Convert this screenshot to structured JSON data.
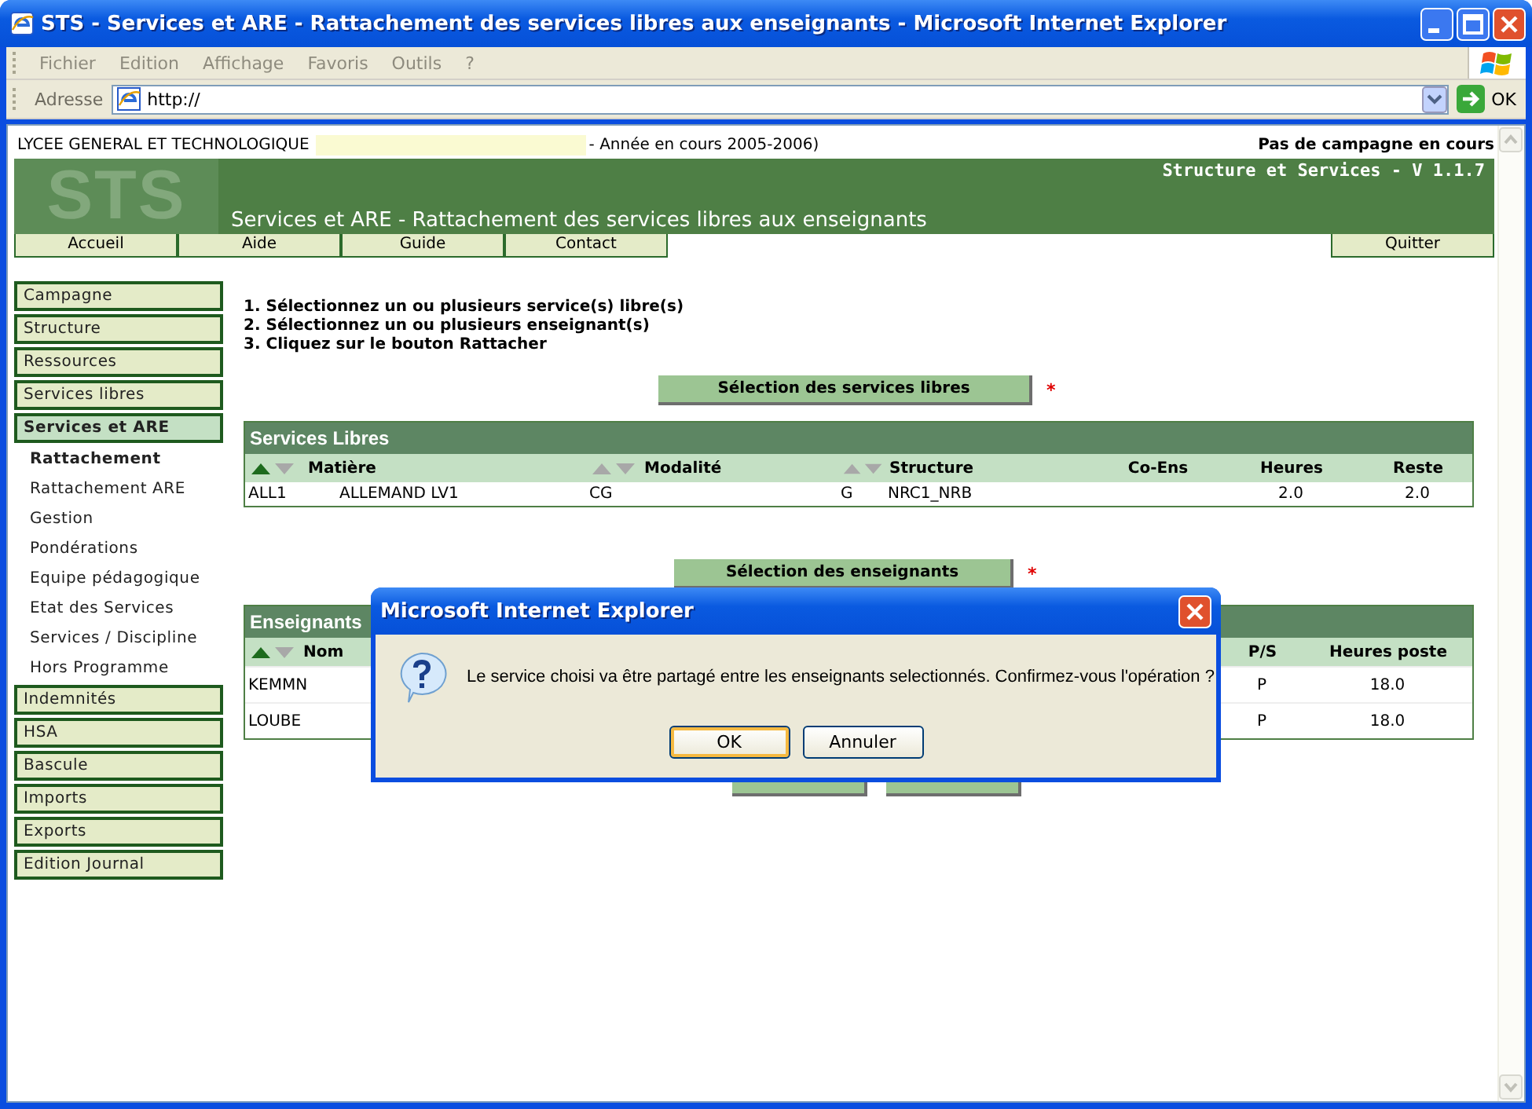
{
  "window": {
    "title": "STS - Services et ARE - Rattachement des services libres aux enseignants - Microsoft Internet Explorer"
  },
  "menu": [
    "Fichier",
    "Edition",
    "Affichage",
    "Favoris",
    "Outils",
    "?"
  ],
  "address": {
    "label": "Adresse",
    "value": "http://",
    "go": "OK"
  },
  "header": {
    "school": "LYCEE GENERAL ET TECHNOLOGIQUE",
    "year": "- Année en cours 2005-2006)",
    "campaign": "Pas de campagne en cours",
    "app": "Structure et Services - V 1.1.7",
    "logo": "STS",
    "page_title": "Services et ARE - Rattachement des services libres aux enseignants"
  },
  "nav": {
    "left": [
      "Accueil",
      "Aide",
      "Guide",
      "Contact"
    ],
    "right": [
      "Quitter"
    ]
  },
  "sidebar": [
    {
      "label": "Campagne",
      "kind": "section",
      "selected": false
    },
    {
      "label": "Structure",
      "kind": "section",
      "selected": false
    },
    {
      "label": "Ressources",
      "kind": "section",
      "selected": false
    },
    {
      "label": "Services libres",
      "kind": "section",
      "selected": false
    },
    {
      "label": "Services et ARE",
      "kind": "section",
      "selected": true
    },
    {
      "label": "Rattachement",
      "kind": "link",
      "selected": true
    },
    {
      "label": "Rattachement ARE",
      "kind": "link",
      "selected": false
    },
    {
      "label": "Gestion",
      "kind": "link",
      "selected": false
    },
    {
      "label": "Pondérations",
      "kind": "link",
      "selected": false
    },
    {
      "label": "Equipe pédagogique",
      "kind": "link",
      "selected": false
    },
    {
      "label": "Etat des Services",
      "kind": "link",
      "selected": false
    },
    {
      "label": "Services / Discipline",
      "kind": "link",
      "selected": false
    },
    {
      "label": "Hors Programme",
      "kind": "link",
      "selected": false
    },
    {
      "label": "Indemnités",
      "kind": "section",
      "selected": false
    },
    {
      "label": "HSA",
      "kind": "section",
      "selected": false
    },
    {
      "label": "Bascule",
      "kind": "section",
      "selected": false
    },
    {
      "label": "Imports",
      "kind": "section",
      "selected": false
    },
    {
      "label": "Exports",
      "kind": "section",
      "selected": false
    },
    {
      "label": "Edition Journal",
      "kind": "section",
      "selected": false
    }
  ],
  "instructions": [
    "1. Sélectionnez un ou plusieurs service(s) libre(s)",
    "2. Sélectionnez un ou plusieurs enseignant(s)",
    "3. Cliquez sur le bouton Rattacher"
  ],
  "services": {
    "select_button": "Sélection des services libres",
    "marker": "*",
    "title": "Services Libres",
    "columns": [
      {
        "sorted": true
      },
      {
        "label": "Matière"
      },
      {
        "label": "Modalité",
        "sorted": false
      },
      {
        "sorted": false
      },
      {
        "label": "Structure"
      },
      {
        "label": "Co-Ens"
      },
      {
        "label": "Heures"
      },
      {
        "label": "Reste"
      }
    ],
    "rows": [
      [
        "ALL1",
        "ALLEMAND LV1",
        "CG",
        "G",
        "NRC1_NRB",
        "",
        "2.0",
        "2.0"
      ]
    ]
  },
  "teachers": {
    "select_button": "Sélection des enseignants",
    "marker": "*",
    "title": "Enseignants",
    "columns": [
      {
        "label": "Nom",
        "sorted": true
      },
      {
        "label": "P/S"
      },
      {
        "label": "Heures poste"
      }
    ],
    "rows": [
      [
        "KEMMN",
        "P",
        "18.0"
      ],
      [
        "LOUBE",
        "P",
        "18.0"
      ]
    ]
  },
  "actions": [
    {
      "kind": "button"
    },
    {
      "kind": "button"
    }
  ],
  "dialog": {
    "title": "Microsoft Internet Explorer",
    "message": "Le service choisi va être partagé entre les enseignants selectionnés. Confirmez-vous l'opération ?",
    "buttons": [
      {
        "label": "OK",
        "focused": true
      },
      {
        "label": "Annuler",
        "focused": false
      }
    ]
  }
}
